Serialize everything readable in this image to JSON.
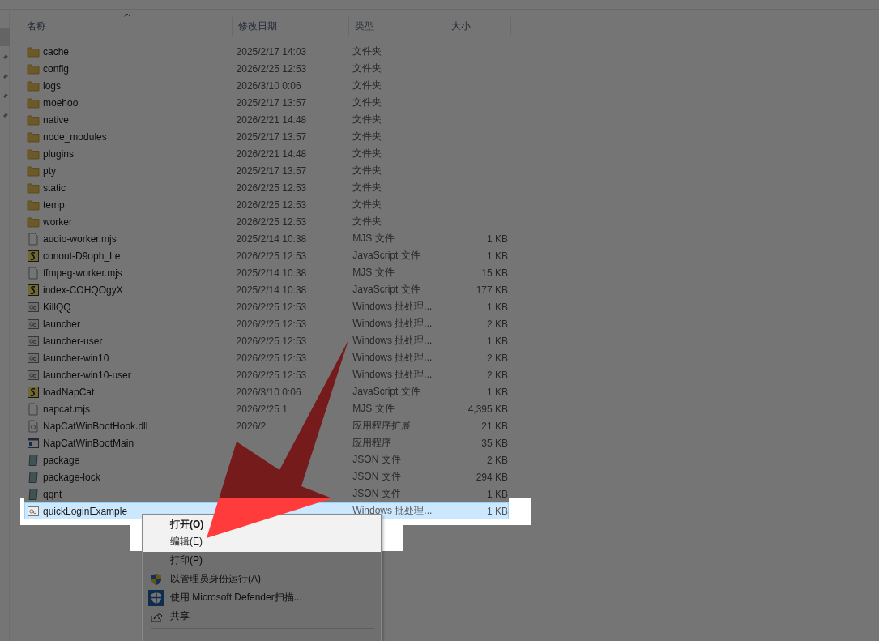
{
  "columns": [
    {
      "label": "名称",
      "sorted": true
    },
    {
      "label": "修改日期",
      "sorted": false
    },
    {
      "label": "类型",
      "sorted": false
    },
    {
      "label": "大小",
      "sorted": false
    }
  ],
  "files": [
    {
      "kind": "folder",
      "name": "cache",
      "date": "2025/2/17 14:03",
      "type": "文件夹",
      "selected": false
    },
    {
      "kind": "folder",
      "name": "config",
      "date": "2026/2/25 12:53",
      "type": "文件夹",
      "selected": false
    },
    {
      "kind": "folder",
      "name": "logs",
      "date": "2026/3/10 0:06",
      "type": "文件夹",
      "selected": false
    },
    {
      "kind": "folder",
      "name": "moehoo",
      "date": "2025/2/17 13:57",
      "type": "文件夹",
      "selected": false
    },
    {
      "kind": "folder",
      "name": "native",
      "date": "2026/2/21 14:48",
      "type": "文件夹",
      "selected": false
    },
    {
      "kind": "folder",
      "name": "node_modules",
      "date": "2025/2/17 13:57",
      "type": "文件夹",
      "selected": false
    },
    {
      "kind": "folder",
      "name": "plugins",
      "date": "2026/2/21 14:48",
      "type": "文件夹",
      "selected": false
    },
    {
      "kind": "folder",
      "name": "pty",
      "date": "2025/2/17 13:57",
      "type": "文件夹",
      "selected": false
    },
    {
      "kind": "folder",
      "name": "static",
      "date": "2026/2/25 12:53",
      "type": "文件夹",
      "selected": false
    },
    {
      "kind": "folder",
      "name": "temp",
      "date": "2026/2/25 12:53",
      "type": "文件夹",
      "selected": false
    },
    {
      "kind": "folder",
      "name": "worker",
      "date": "2026/2/25 12:53",
      "type": "文件夹",
      "selected": false
    },
    {
      "kind": "file",
      "name": "audio-worker.mjs",
      "date": "2025/2/14 10:38",
      "type": "MJS 文件",
      "size": "1 KB",
      "selected": false
    },
    {
      "kind": "script",
      "name": "conout-D9oph_Le",
      "date": "2026/2/25 12:53",
      "type": "JavaScript 文件",
      "size": "1 KB",
      "selected": false
    },
    {
      "kind": "file",
      "name": "ffmpeg-worker.mjs",
      "date": "2025/2/14 10:38",
      "type": "MJS 文件",
      "size": "15 KB",
      "selected": false
    },
    {
      "kind": "script",
      "name": "index-COHQOgyX",
      "date": "2025/2/14 10:38",
      "type": "JavaScript 文件",
      "size": "177 KB",
      "selected": false
    },
    {
      "kind": "batch",
      "name": "KillQQ",
      "date": "2026/2/25 12:53",
      "type": "Windows 批处理...",
      "size": "1 KB",
      "selected": false
    },
    {
      "kind": "batch",
      "name": "launcher",
      "date": "2026/2/25 12:53",
      "type": "Windows 批处理...",
      "size": "2 KB",
      "selected": false
    },
    {
      "kind": "batch",
      "name": "launcher-user",
      "date": "2026/2/25 12:53",
      "type": "Windows 批处理...",
      "size": "1 KB",
      "selected": false
    },
    {
      "kind": "batch",
      "name": "launcher-win10",
      "date": "2026/2/25 12:53",
      "type": "Windows 批处理...",
      "size": "2 KB",
      "selected": false
    },
    {
      "kind": "batch",
      "name": "launcher-win10-user",
      "date": "2026/2/25 12:53",
      "type": "Windows 批处理...",
      "size": "2 KB",
      "selected": false
    },
    {
      "kind": "script",
      "name": "loadNapCat",
      "date": "2026/3/10 0:06",
      "type": "JavaScript 文件",
      "size": "1 KB",
      "selected": false
    },
    {
      "kind": "file",
      "name": "napcat.mjs",
      "date": "2026/2/25 1",
      "type": "MJS 文件",
      "size": "4,395 KB",
      "selected": false
    },
    {
      "kind": "dll",
      "name": "NapCatWinBootHook.dll",
      "date": "2026/2",
      "type": "应用程序扩展",
      "size": "21 KB",
      "selected": false
    },
    {
      "kind": "app",
      "name": "NapCatWinBootMain",
      "type": "应用程序",
      "size": "35 KB",
      "selected": false
    },
    {
      "kind": "json",
      "name": "package",
      "type": "JSON 文件",
      "size": "2 KB",
      "selected": false
    },
    {
      "kind": "json",
      "name": "package-lock",
      "type": "JSON 文件",
      "size": "294 KB",
      "selected": false
    },
    {
      "kind": "json",
      "name": "qqnt",
      "type": "JSON 文件",
      "size": "1 KB",
      "selected": false
    },
    {
      "kind": "batch",
      "name": "quickLoginExample",
      "type": "Windows 批处理...",
      "size": "1 KB",
      "selected": true
    }
  ],
  "context_menu": [
    {
      "kind": "item",
      "label": "打开(O)",
      "default": true
    },
    {
      "kind": "item",
      "label": "编辑(E)",
      "default": false
    },
    {
      "kind": "item",
      "label": "打印(P)",
      "default": false
    },
    {
      "kind": "shield",
      "label": "以管理员身份运行(A)",
      "default": false
    },
    {
      "kind": "defender",
      "label": "使用 Microsoft Defender扫描...",
      "default": false
    },
    {
      "kind": "share",
      "label": "共享",
      "default": false
    },
    {
      "kind": "separator"
    }
  ]
}
